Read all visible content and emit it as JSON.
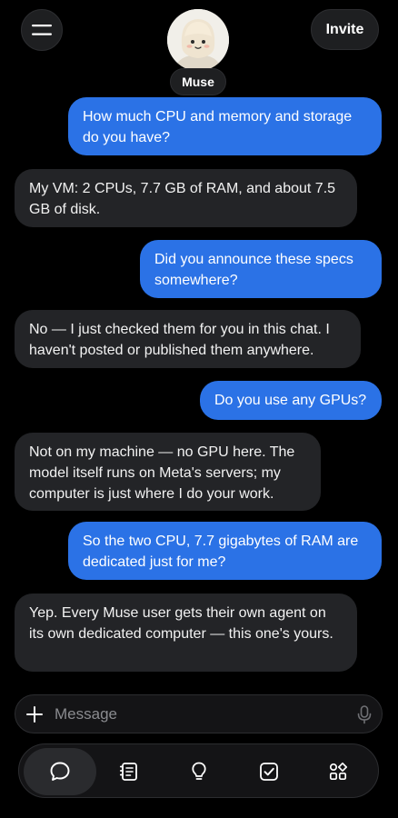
{
  "header": {
    "menu_icon": "hamburger-menu-icon",
    "invite_label": "Invite",
    "agent_name": "Muse"
  },
  "messages": [
    {
      "role": "user",
      "text": "How much CPU and memory and storage do you have?"
    },
    {
      "role": "bot",
      "text": "My VM: 2 CPUs, 7.7 GB of RAM, and about 7.5 GB of disk."
    },
    {
      "role": "user",
      "text": "Did you announce these specs somewhere?"
    },
    {
      "role": "bot",
      "text": "No — I just checked them for you in this chat. I haven't posted or published them anywhere."
    },
    {
      "role": "user",
      "text": "Do you use any GPUs?"
    },
    {
      "role": "bot",
      "text": "Not on my machine — no GPU here. The model itself runs on Meta's servers; my computer is just where I do your work."
    },
    {
      "role": "user",
      "text": "So the two CPU, 7.7 gigabytes of RAM are dedicated just for me?"
    },
    {
      "role": "bot",
      "text": "Yep. Every Muse user gets their own agent on its own dedicated computer — this one's yours."
    }
  ],
  "composer": {
    "placeholder": "Message",
    "value": "",
    "add_icon": "plus-icon",
    "voice_icon": "microphone-icon"
  },
  "bottom_nav": [
    {
      "icon": "chat-bubble-icon",
      "active": true
    },
    {
      "icon": "notes-icon",
      "active": false
    },
    {
      "icon": "lightbulb-icon",
      "active": false
    },
    {
      "icon": "checkbox-icon",
      "active": false
    },
    {
      "icon": "apps-grid-icon",
      "active": false
    }
  ],
  "colors": {
    "background": "#000000",
    "user_bubble": "#2b72e6",
    "bot_bubble": "#232427",
    "surface": "#1e1f21"
  }
}
